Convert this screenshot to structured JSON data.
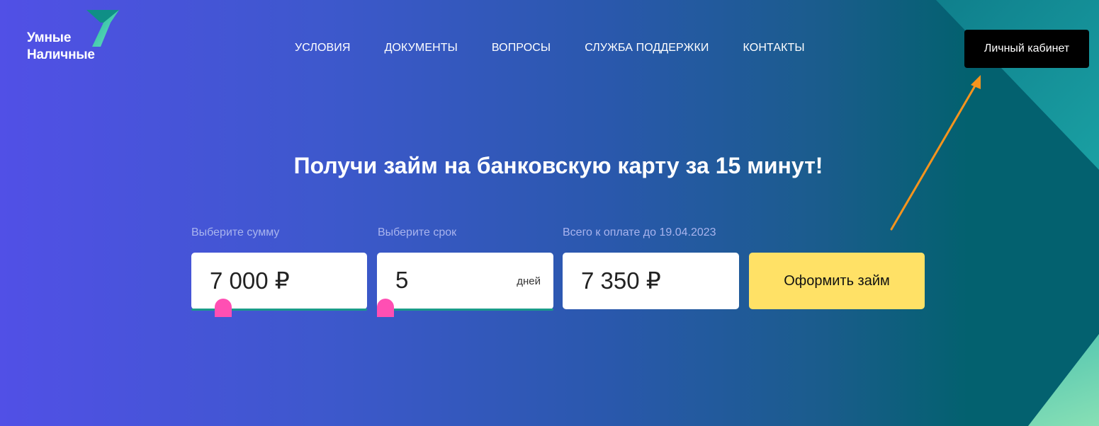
{
  "logo": {
    "line1": "Умные",
    "line2": "Наличные"
  },
  "nav": {
    "items": [
      "УСЛОВИЯ",
      "ДОКУМЕНТЫ",
      "ВОПРОСЫ",
      "СЛУЖБА ПОДДЕРЖКИ",
      "КОНТАКТЫ"
    ]
  },
  "header": {
    "cabinet_label": "Личный кабинет"
  },
  "hero": {
    "headline": "Получи займ на банковскую карту за 15 минут!"
  },
  "calculator": {
    "amount": {
      "label": "Выберите сумму",
      "value": "7 000 ₽"
    },
    "term": {
      "label": "Выберите срок",
      "value": "5",
      "unit": "дней"
    },
    "total": {
      "label": "Всего к оплате до 19.04.2023",
      "value": "7 350 ₽"
    },
    "submit_label": "Оформить займ"
  },
  "colors": {
    "accent_yellow": "#ffe166",
    "slider_thumb": "#ff4fb3",
    "slider_track": "#1a9b8a",
    "arrow": "#f7941d"
  }
}
